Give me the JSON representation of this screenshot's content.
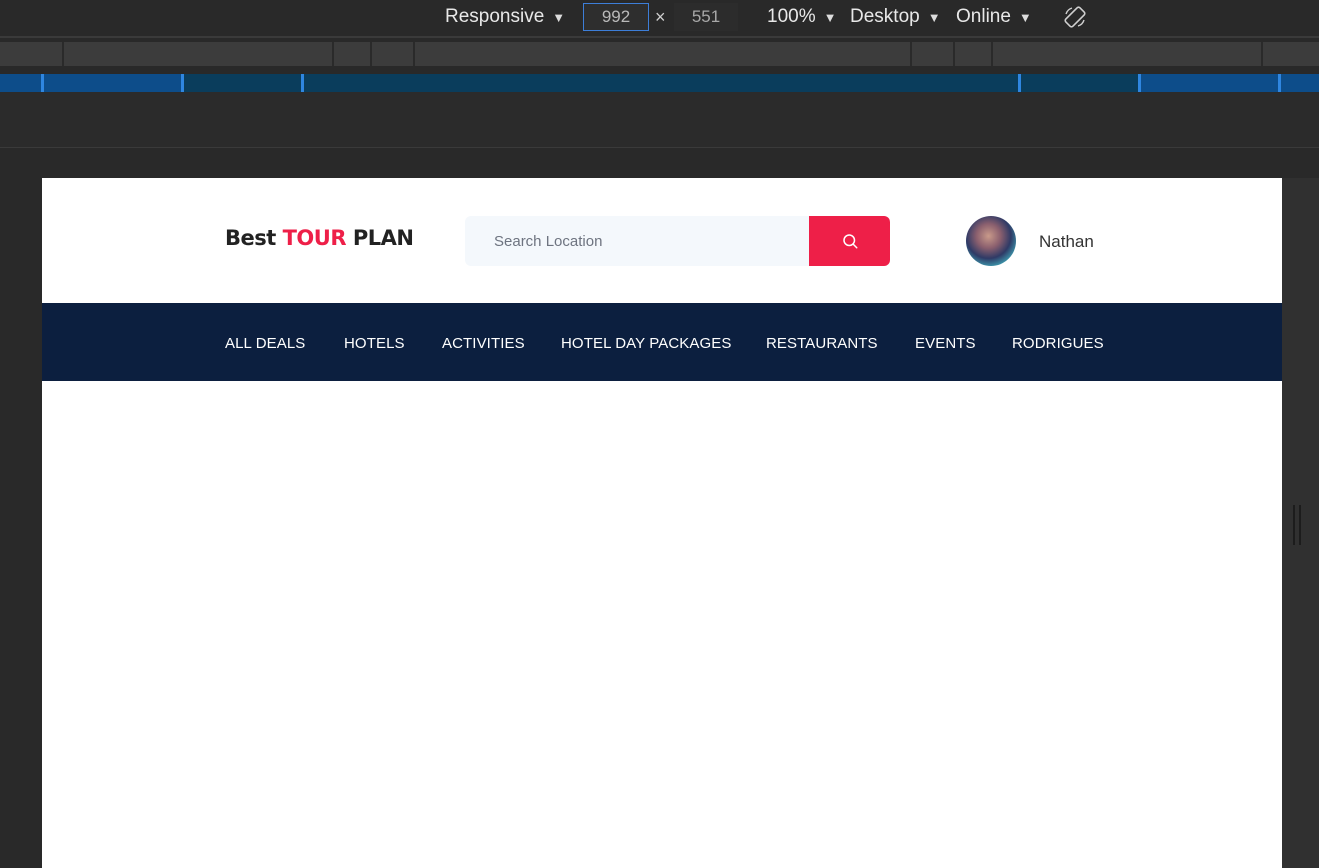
{
  "devtools": {
    "device": "Responsive",
    "width": "992",
    "times": "×",
    "height": "551",
    "zoom": "100%",
    "mode": "Desktop",
    "network": "Online",
    "caret": "▼",
    "icons": [
      "rotate-icon",
      "search-icon"
    ]
  },
  "site": {
    "logo": {
      "part1": "Best",
      "part2": "TOUR",
      "part3": "PLAN"
    },
    "search": {
      "placeholder": "Search Location"
    },
    "user": {
      "name": "Nathan"
    },
    "nav": [
      "ALL DEALS",
      "HOTELS",
      "ACTIVITIES",
      "HOTEL DAY PACKAGES",
      "RESTAURANTS",
      "EVENTS",
      "RODRIGUES"
    ],
    "colors": {
      "accent": "#ee1f48",
      "nav_bg": "#0c1f3f",
      "search_bg": "#f4f8fc"
    }
  }
}
